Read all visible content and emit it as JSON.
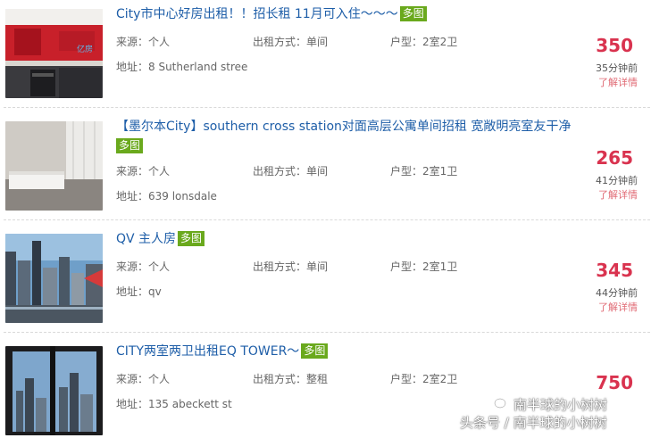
{
  "listings": [
    {
      "title": "City市中心好房出租！！招长租 11月可入住～～～",
      "badge": "多图",
      "source": "来源：个人",
      "rent_type": "出租方式：单间",
      "layout": "户型：2室2卫",
      "address": "地址：8 Sutherland stree",
      "price": "350",
      "time_ago": "35分钟前",
      "detail_link": "了解详情",
      "thumb_icon": "kitchen-photo"
    },
    {
      "title": "【墨尔本City】southern cross station对面高层公寓单间招租 宽敞明亮室友干净",
      "badge": "多图",
      "source": "来源：个人",
      "rent_type": "出租方式：单间",
      "layout": "户型：2室1卫",
      "address": "地址：639 lonsdale",
      "price": "265",
      "time_ago": "41分钟前",
      "detail_link": "了解详情",
      "thumb_icon": "bedroom-photo"
    },
    {
      "title": "QV 主人房",
      "badge": "多图",
      "source": "来源：个人",
      "rent_type": "出租方式：单间",
      "layout": "户型：2室1卫",
      "address": "地址：qv",
      "price": "345",
      "time_ago": "44分钟前",
      "detail_link": "了解详情",
      "thumb_icon": "city-view-photo"
    },
    {
      "title": "CITY两室两卫出租EQ TOWER～",
      "badge": "多图",
      "source": "来源：个人",
      "rent_type": "出租方式：整租",
      "layout": "户型：2室2卫",
      "address": "地址：135 abeckett st",
      "price": "750",
      "time_ago": "",
      "detail_link": "",
      "thumb_icon": "window-view-photo"
    }
  ],
  "watermark": {
    "line1": "南半球的小树树",
    "line2": "头条号 / 南半球的小树树"
  },
  "colors": {
    "title": "#1e5ea8",
    "badge": "#6aa91d",
    "price": "#d9334f",
    "detail": "#e06a74"
  }
}
